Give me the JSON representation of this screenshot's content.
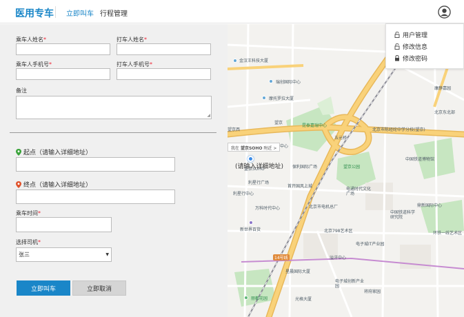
{
  "header": {
    "brand": "医用专车",
    "nav": [
      "立即叫车",
      "行程管理"
    ]
  },
  "user_menu": {
    "items": [
      "用户管理",
      "修改信息",
      "修改密码"
    ]
  },
  "form": {
    "passenger_name_label": "乘车人姓名",
    "caller_name_label": "打车人姓名",
    "passenger_phone_label": "乘车人手机号",
    "caller_phone_label": "打车人手机号",
    "remark_label": "备注",
    "start_label": "起点（请输入详细地址）",
    "end_label": "终点（请输入详细地址）",
    "time_label": "乘车时间",
    "driver_label": "选择司机",
    "driver_selected": "张三",
    "submit_label": "立即叫车",
    "cancel_label": "立即取消",
    "required_mark": "*"
  },
  "map": {
    "tooltip_prefix": "我在",
    "tooltip_place": "望京SOHO",
    "tooltip_suffix": "附近 >",
    "address_hint": "(请输入详细地址)",
    "road_badge": "14号线",
    "pois": [
      "金汉王科技大厦",
      "瑞创国际中心",
      "摩托罗拉大厦",
      "望京",
      "昆泰嘉瑞中心",
      "望京西",
      "中心",
      "五元桥",
      "北京市陈经纶中学分校(望京)",
      "望京SOHO",
      "保利国际广场",
      "望京公园",
      "利星行广场",
      "首开国风上城",
      "利星行中心",
      "电通时代文化广场",
      "万科时代中心",
      "北京市电机总厂",
      "新世界百货",
      "北京798艺术区",
      "电子城IT产业园",
      "溢洋中心",
      "星晨国际大厦",
      "电子城创新产业园",
      "将府家园",
      "丽都花园",
      "光格大厦",
      "中国铁道博物馆",
      "环铁一线艺术区",
      "北京东北部",
      "鼎新国际中心",
      "中国铁道科学研究院",
      "康静嘉园"
    ],
    "colors": {
      "road_major": "#f9d27a",
      "road_outline": "#e8b85a",
      "green": "#c7e6c1",
      "water": "#bcd7ef",
      "rail": "#8c8c96"
    }
  }
}
